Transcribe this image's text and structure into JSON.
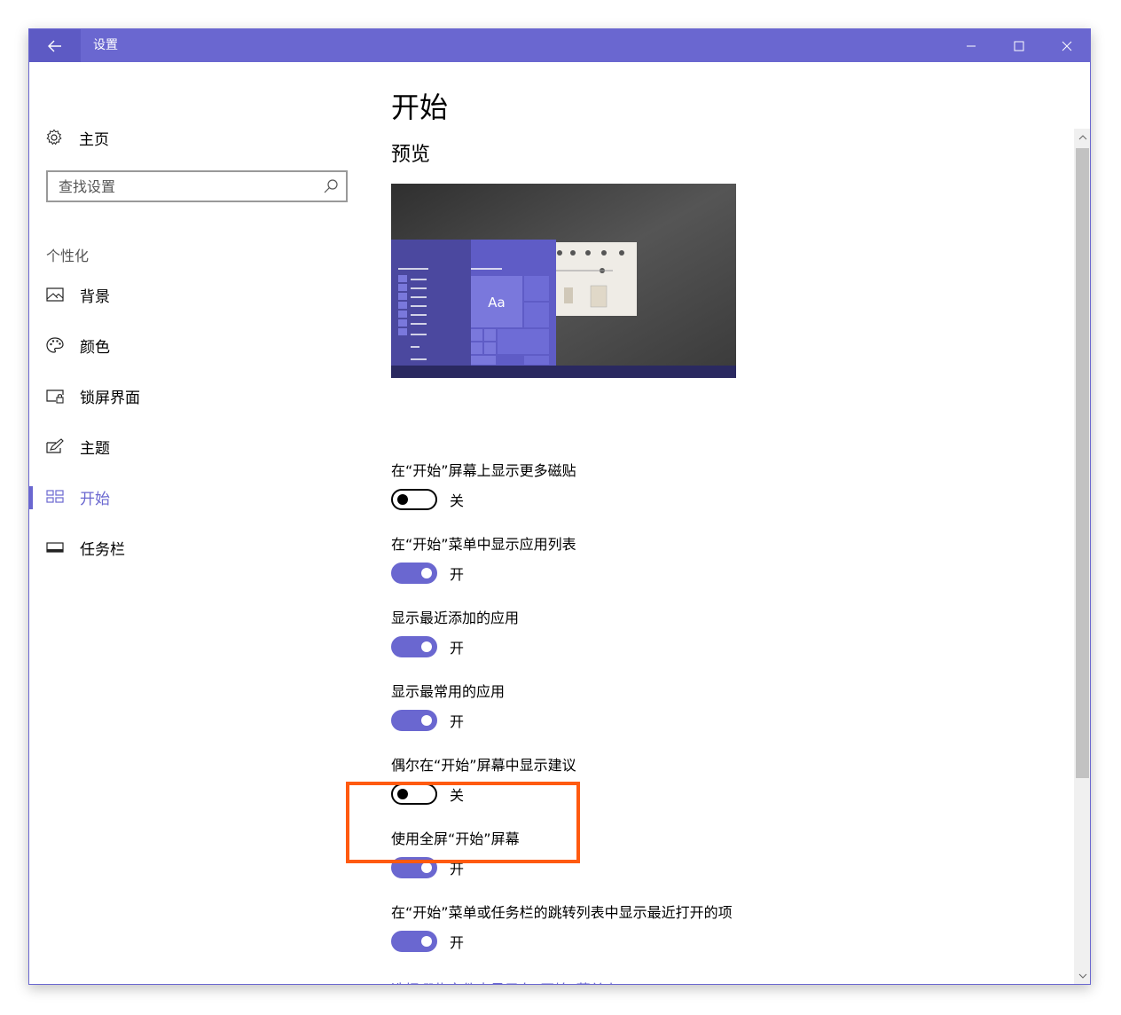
{
  "window": {
    "title": "设置"
  },
  "sidebar": {
    "home_label": "主页",
    "search_placeholder": "查找设置",
    "section_title": "个性化",
    "items": [
      {
        "label": "背景",
        "icon": "picture-icon",
        "active": false
      },
      {
        "label": "颜色",
        "icon": "palette-icon",
        "active": false
      },
      {
        "label": "锁屏界面",
        "icon": "lock-screen-icon",
        "active": false
      },
      {
        "label": "主题",
        "icon": "theme-icon",
        "active": false
      },
      {
        "label": "开始",
        "icon": "start-tiles-icon",
        "active": true
      },
      {
        "label": "任务栏",
        "icon": "taskbar-icon",
        "active": false
      }
    ]
  },
  "main": {
    "title": "开始",
    "preview_heading": "预览",
    "preview_tile_text": "Aa",
    "settings": [
      {
        "label": "在“开始”屏幕上显示更多磁贴",
        "on": false,
        "state": "关"
      },
      {
        "label": "在“开始”菜单中显示应用列表",
        "on": true,
        "state": "开"
      },
      {
        "label": "显示最近添加的应用",
        "on": true,
        "state": "开"
      },
      {
        "label": "显示最常用的应用",
        "on": true,
        "state": "开"
      },
      {
        "label": "偶尔在“开始”屏幕中显示建议",
        "on": false,
        "state": "关"
      },
      {
        "label": "使用全屏“开始”屏幕",
        "on": true,
        "state": "开"
      },
      {
        "label": "在“开始”菜单或任务栏的跳转列表中显示最近打开的项",
        "on": true,
        "state": "开"
      }
    ],
    "link": "选择哪些文件夹显示在“开始”菜单上"
  },
  "colors": {
    "accent": "#6a67d0",
    "highlight": "#ff5a10"
  }
}
